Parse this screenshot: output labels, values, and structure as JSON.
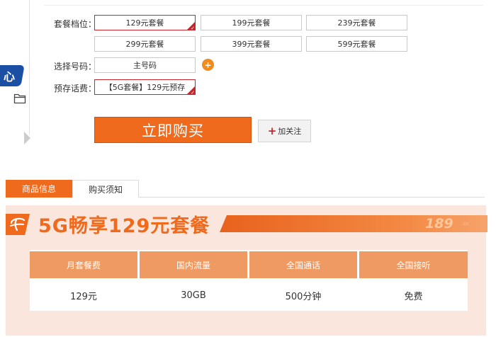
{
  "sidebar": {
    "tab_label": "心",
    "icon_folder": "folder-icon",
    "icon_arrow": "chevron-right-icon"
  },
  "form": {
    "plan_label": "套餐档位：",
    "plan_options": [
      "129元套餐",
      "199元套餐",
      "239元套餐",
      "299元套餐",
      "399元套餐",
      "599元套餐"
    ],
    "selected_plan": "129元套餐",
    "number_label": "选择号码：",
    "number_value": "主号码",
    "add_icon": "plus-circle-icon",
    "prepaid_label": "预存话费：",
    "prepaid_value": "【5G套餐】129元预存"
  },
  "actions": {
    "buy_label": "立即购买",
    "follow_label": "加关注"
  },
  "tabs": [
    {
      "label": "商品信息",
      "active": true
    },
    {
      "label": "购买须知",
      "active": false
    }
  ],
  "banner": {
    "title": "5G畅享129元套餐",
    "number": "189",
    "number_suffix": ".cn",
    "logo_icon": "china-telecom-logo-icon"
  },
  "plan_table": {
    "headers": [
      "月套餐费",
      "国内流量",
      "全国通话",
      "全国接听"
    ],
    "values": [
      "129元",
      "30GB",
      "500分钟",
      "免费"
    ]
  },
  "colors": {
    "accent": "#ef6a1d",
    "selected_border": "#c8262c",
    "sidebar_blue": "#1b4fa4",
    "table_header": "#ef9a62",
    "banner_bg": "#fbe6dd"
  }
}
